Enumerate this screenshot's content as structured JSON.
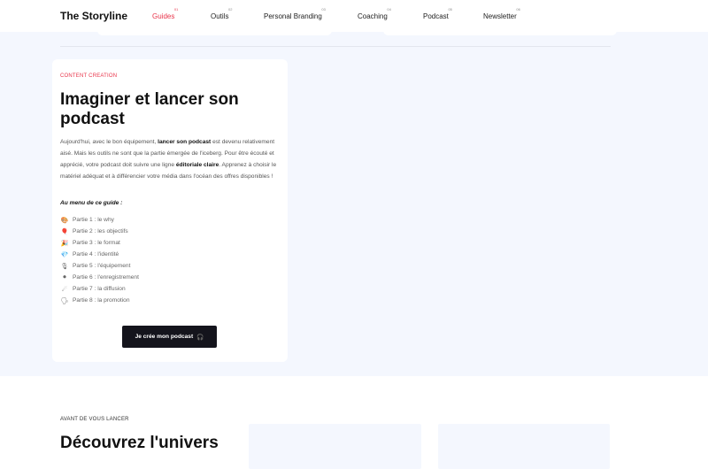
{
  "nav": {
    "logo": "The Storyline",
    "items": [
      {
        "label": "Guides",
        "num": "01",
        "active": true
      },
      {
        "label": "Outils",
        "num": "02",
        "active": false
      },
      {
        "label": "Personal Branding",
        "num": "03",
        "active": false
      },
      {
        "label": "Coaching",
        "num": "04",
        "active": false
      },
      {
        "label": "Podcast",
        "num": "05",
        "active": false
      },
      {
        "label": "Newsletter",
        "num": "06",
        "active": false
      }
    ]
  },
  "card": {
    "eyebrow": "CONTENT CREATION",
    "title": "Imaginer et lancer son podcast",
    "desc": {
      "p1": "Aujourd'hui, avec le bon équipement, ",
      "b1": "lancer son podcast",
      "p2": " est devenu relativement aisé. Mais les outils ne sont que la partie émergée de l'iceberg. Pour être écouté et apprécié, votre podcast doit suivre une ligne ",
      "b2": "éditoriale claire",
      "p3": ". Apprenez à choisir le matériel adéquat et à différencier votre média dans l'océan des offres disponibles !"
    },
    "menu_title": "Au menu de ce guide :",
    "parts": [
      {
        "icon": "🎨",
        "label": "Partie 1 : le why"
      },
      {
        "icon": "🎈",
        "label": "Partie 2 : les objectifs"
      },
      {
        "icon": "🎉",
        "label": "Partie 3 : le format"
      },
      {
        "icon": "💎",
        "label": "Partie 4 : l'identité"
      },
      {
        "icon": "🎙",
        "label": "Partie 5 : l'équipement"
      },
      {
        "icon": "⏺",
        "label": "Partie 6 : l'enregistrement"
      },
      {
        "icon": "☄",
        "label": "Partie 7 : la diffusion"
      },
      {
        "icon": "🗣",
        "label": "Partie 8 : la promotion"
      }
    ],
    "cta": "Je crée mon podcast",
    "cta_icon": "🎧"
  },
  "section2": {
    "eyebrow": "AVANT DE VOUS LANCER",
    "title": "Découvrez l'univers"
  },
  "colors": {
    "accent": "#e8344a",
    "band": "#f4f7fe",
    "cta": "#14141c"
  }
}
